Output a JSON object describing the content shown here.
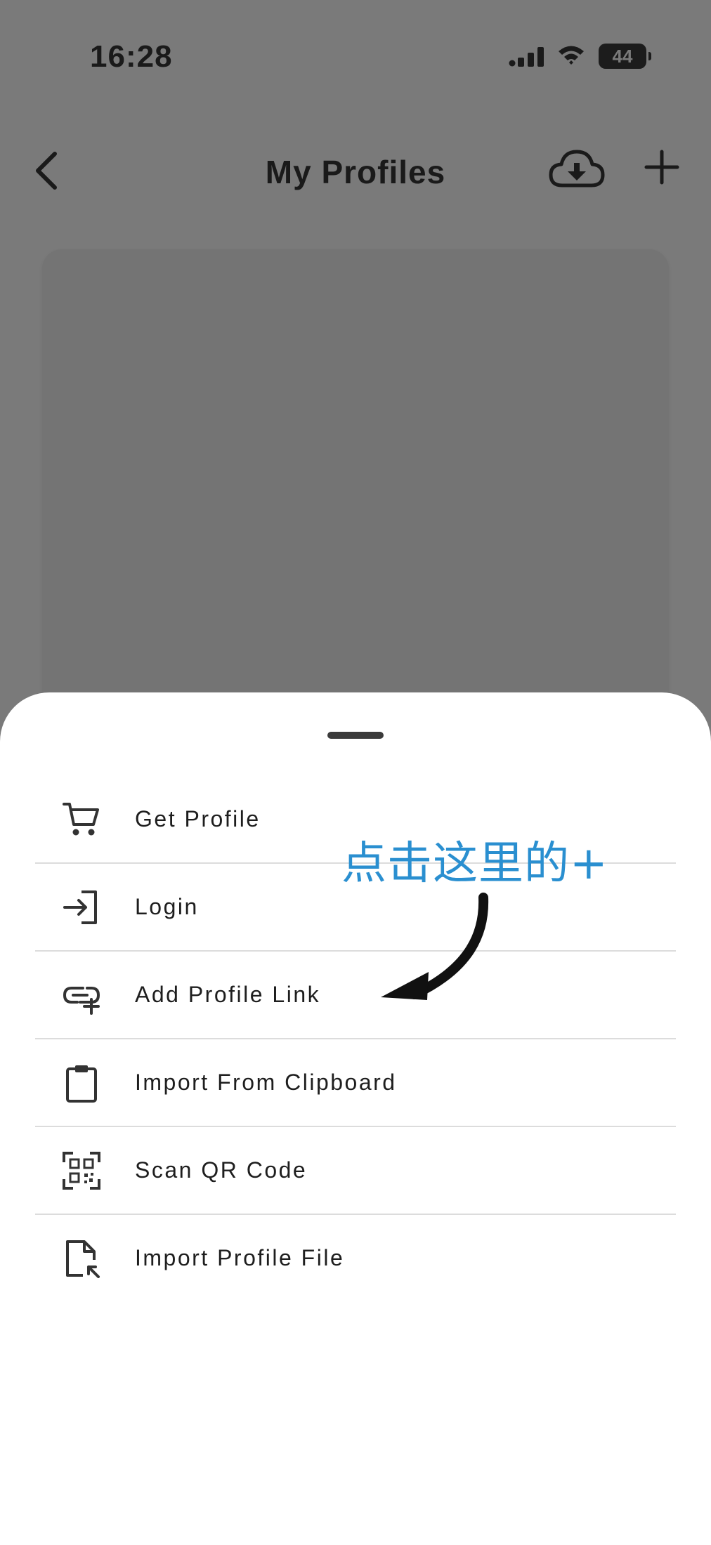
{
  "status_bar": {
    "time": "16:28",
    "battery": "44"
  },
  "nav": {
    "title": "My Profiles",
    "back_icon": "chevron-left-icon",
    "download_icon": "cloud-download-icon",
    "add_icon": "plus-icon"
  },
  "sheet": {
    "items": [
      {
        "label": "Get Profile",
        "icon": "cart-icon"
      },
      {
        "label": "Login",
        "icon": "login-icon"
      },
      {
        "label": "Add Profile Link",
        "icon": "link-add-icon"
      },
      {
        "label": "Import From Clipboard",
        "icon": "clipboard-icon"
      },
      {
        "label": "Scan QR Code",
        "icon": "qr-code-icon"
      },
      {
        "label": "Import Profile File",
        "icon": "file-import-icon"
      }
    ]
  },
  "annotation": {
    "text": "点击这里的+",
    "color": "#2a8fd0"
  },
  "colors": {
    "overlay": "#7a7a7a",
    "sheet": "#ffffff",
    "text": "#1e1e1e",
    "divider": "#dcdcdc"
  }
}
